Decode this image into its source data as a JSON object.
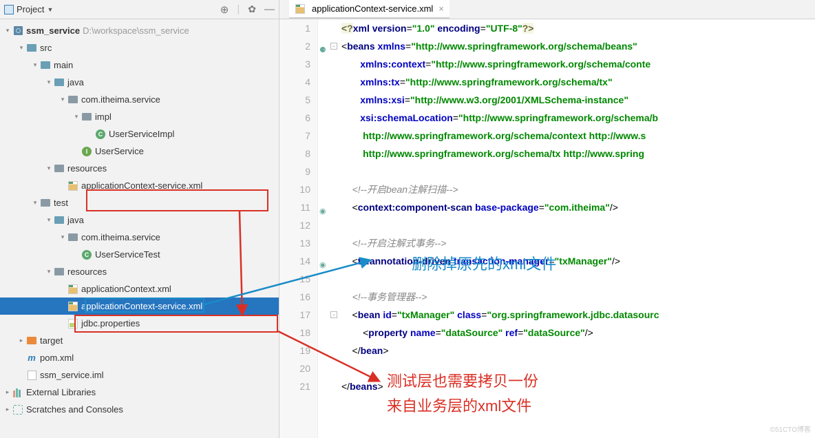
{
  "sidebar": {
    "header": {
      "label": "Project"
    },
    "tree": [
      {
        "level": 0,
        "expand": "down",
        "icon": "module",
        "text": "ssm_service",
        "bold": true,
        "suffix": "D:\\workspace\\ssm_service"
      },
      {
        "level": 1,
        "expand": "down",
        "icon": "folder-blue",
        "text": "src"
      },
      {
        "level": 2,
        "expand": "down",
        "icon": "folder-blue",
        "text": "main"
      },
      {
        "level": 3,
        "expand": "down",
        "icon": "folder-blue",
        "text": "java"
      },
      {
        "level": 4,
        "expand": "down",
        "icon": "folder",
        "text": "com.itheima.service"
      },
      {
        "level": 5,
        "expand": "down",
        "icon": "folder",
        "text": "impl"
      },
      {
        "level": 6,
        "expand": "none",
        "icon": "class-c",
        "text": "UserServiceImpl"
      },
      {
        "level": 5,
        "expand": "none",
        "icon": "class-i",
        "text": "UserService"
      },
      {
        "level": 3,
        "expand": "down",
        "icon": "folder",
        "text": "resources"
      },
      {
        "level": 4,
        "expand": "none",
        "icon": "xml",
        "text": "applicationContext-service.xml"
      },
      {
        "level": 2,
        "expand": "down",
        "icon": "folder",
        "text": "test"
      },
      {
        "level": 3,
        "expand": "down",
        "icon": "folder-blue",
        "text": "java"
      },
      {
        "level": 4,
        "expand": "down",
        "icon": "folder",
        "text": "com.itheima.service"
      },
      {
        "level": 5,
        "expand": "none",
        "icon": "class-c",
        "text": "UserServiceTest"
      },
      {
        "level": 3,
        "expand": "down",
        "icon": "folder",
        "text": "resources"
      },
      {
        "level": 4,
        "expand": "none",
        "icon": "xml",
        "text": "applicationContext.xml"
      },
      {
        "level": 4,
        "expand": "none",
        "icon": "xml",
        "text": "applicationContext-service.xml",
        "selected": true
      },
      {
        "level": 4,
        "expand": "none",
        "icon": "yml",
        "text": "jdbc.properties"
      },
      {
        "level": 1,
        "expand": "right",
        "icon": "folder-orange",
        "text": "target"
      },
      {
        "level": 1,
        "expand": "none",
        "icon": "m",
        "text": "pom.xml"
      },
      {
        "level": 1,
        "expand": "none",
        "icon": "file",
        "text": "ssm_service.iml"
      },
      {
        "level": 0,
        "expand": "right",
        "icon": "lib",
        "text": "External Libraries"
      },
      {
        "level": 0,
        "expand": "right",
        "icon": "scratch",
        "text": "Scratches and Consoles"
      }
    ]
  },
  "editor": {
    "tab": {
      "label": "applicationContext-service.xml"
    },
    "lines": [
      {
        "n": 1,
        "html": "<span class='t-pi'>&lt;?</span><span class='t-tag'>xml version</span>=<span class='t-str'>\"1.0\"</span> <span class='t-tag'>encoding</span>=<span class='t-str'>\"UTF-8\"</span><span class='t-pi'>?&gt;</span>"
      },
      {
        "n": 2,
        "mark": "⚈",
        "fold": "-",
        "html": "&lt;<span class='t-tag'>beans</span> <span class='t-attr'>xmlns</span>=<span class='t-str'>\"http://www.springframework.org/schema/beans\"</span>"
      },
      {
        "n": 3,
        "html": "       <span class='t-attr'>xmlns:context</span>=<span class='t-str'>\"http://www.springframework.org/schema/conte</span>"
      },
      {
        "n": 4,
        "html": "       <span class='t-attr'>xmlns:tx</span>=<span class='t-str'>\"http://www.springframework.org/schema/tx\"</span>"
      },
      {
        "n": 5,
        "html": "       <span class='t-attr'>xmlns:xsi</span>=<span class='t-str'>\"http://www.w3.org/2001/XMLSchema-instance\"</span>"
      },
      {
        "n": 6,
        "html": "       <span class='t-attr'>xsi:schemaLocation</span>=<span class='t-str'>\"http://www.springframework.org/schema/b</span>"
      },
      {
        "n": 7,
        "html": "<span class='t-str'>        http://www.springframework.org/schema/context http://www.s</span>"
      },
      {
        "n": 8,
        "html": "<span class='t-str'>        http://www.springframework.org/schema/tx http://www.spring</span>"
      },
      {
        "n": 9,
        "html": ""
      },
      {
        "n": 10,
        "html": "    <span class='t-comment'>&lt;!--开启bean注解扫描--&gt;</span>"
      },
      {
        "n": 11,
        "mark": "◉",
        "html": "    &lt;<span class='t-tag'>context:component-scan</span> <span class='t-attr'>base-package</span>=<span class='t-str'>\"com.itheima\"</span>/&gt;"
      },
      {
        "n": 12,
        "html": ""
      },
      {
        "n": 13,
        "html": "    <span class='t-comment'>&lt;!--开启注解式事务--&gt;</span>"
      },
      {
        "n": 14,
        "mark": "◉",
        "html": "    &lt;<span class='t-tag'>tx:annotation-driven</span> <span class='t-attr'>transaction-manager</span>=<span class='t-str'>\"txManager\"</span>/&gt;"
      },
      {
        "n": 15,
        "html": ""
      },
      {
        "n": 16,
        "html": "    <span class='t-comment'>&lt;!--事务管理器--&gt;</span>"
      },
      {
        "n": 17,
        "fold": "-",
        "html": "    &lt;<span class='t-tag'>bean</span> <span class='t-attr'>id</span>=<span class='t-str'>\"txManager\"</span> <span class='t-attr'>class</span>=<span class='t-str'>\"org.springframework.jdbc.datasourc</span>"
      },
      {
        "n": 18,
        "html": "        &lt;<span class='t-tag'>property</span> <span class='t-attr'>name</span>=<span class='t-str'>\"dataSource\"</span> <span class='t-attr'>ref</span>=<span class='t-str'>\"dataSource\"</span>/&gt;"
      },
      {
        "n": 19,
        "html": "    &lt;/<span class='t-tag'>bean</span>&gt;"
      },
      {
        "n": 20,
        "html": ""
      },
      {
        "n": 21,
        "html": "&lt;/<span class='t-tag'>beans</span>&gt;"
      }
    ]
  },
  "annotations": {
    "blue_text": "删除掉原先的xml文件",
    "red_text1": "测试层也需要拷贝一份",
    "red_text2": "来自业务层的xml文件"
  },
  "watermark": "©51CTO博客"
}
